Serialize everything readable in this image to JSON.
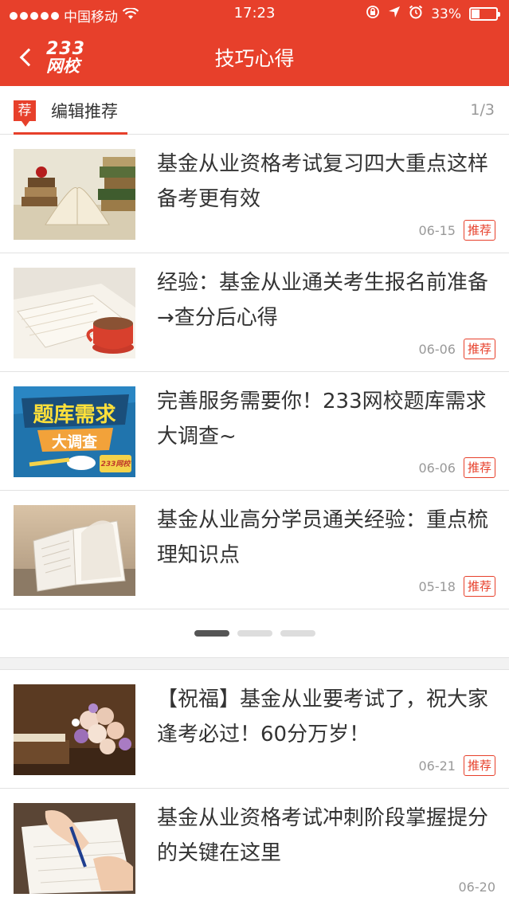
{
  "status_bar": {
    "carrier": "中国移动",
    "time": "17:23",
    "battery_text": "33%",
    "battery_level": 0.33,
    "icons": [
      "signal-dots-icon",
      "wifi-icon",
      "rotation-lock-icon",
      "location-icon",
      "alarm-icon",
      "battery-icon"
    ]
  },
  "nav": {
    "title": "技巧心得",
    "logo_top": "233",
    "logo_bottom": "网校"
  },
  "section": {
    "badge": "荐",
    "title": "编辑推荐",
    "page_indicator": "1/3"
  },
  "carousel_articles": [
    {
      "title": "基金从业资格考试复习四大重点这样备考更有效",
      "date": "06-15",
      "tag": "推荐"
    },
    {
      "title": "经验：基金从业通关考生报名前准备→查分后心得",
      "date": "06-06",
      "tag": "推荐"
    },
    {
      "title": "完善服务需要你！233网校题库需求大调查~",
      "date": "06-06",
      "tag": "推荐"
    },
    {
      "title": "基金从业高分学员通关经验：重点梳理知识点",
      "date": "05-18",
      "tag": "推荐"
    }
  ],
  "banner_image": {
    "line1": "题库需求",
    "line2": "大调查",
    "brand": "233网校"
  },
  "pager": {
    "count": 3,
    "active_index": 0
  },
  "list_articles": [
    {
      "title": "【祝福】基金从业要考试了，祝大家逢考必过！60分万岁！",
      "date": "06-21",
      "tag": "推荐"
    },
    {
      "title": "基金从业资格考试冲刺阶段掌握提分的关键在这里",
      "date": "06-20",
      "tag": ""
    }
  ],
  "colors": {
    "accent": "#e7402b",
    "text": "#333333",
    "muted": "#999999",
    "divider": "#e2e2e2"
  }
}
